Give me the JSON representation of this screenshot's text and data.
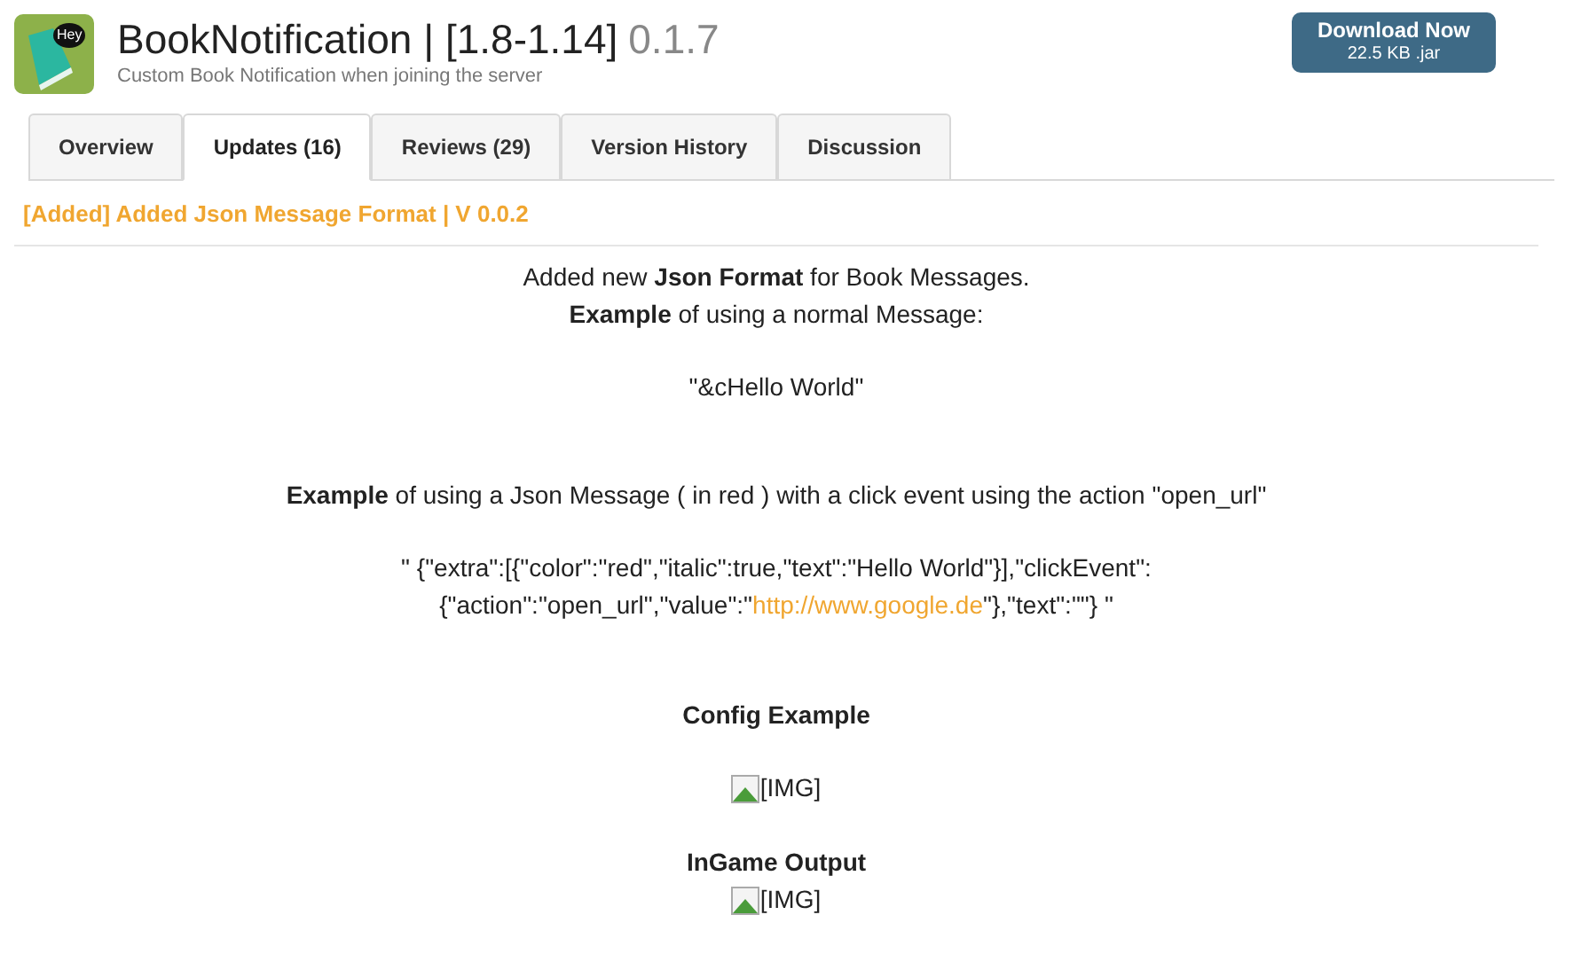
{
  "resource": {
    "name": "BookNotification | [1.8-1.14]",
    "version": "0.1.7",
    "tagline": "Custom Book Notification when joining the server",
    "icon_badge": "Hey"
  },
  "download": {
    "label": "Download Now",
    "detail": "22.5 KB .jar"
  },
  "tabs": [
    {
      "label": "Overview",
      "selected": false
    },
    {
      "label": "Updates (16)",
      "selected": true
    },
    {
      "label": "Reviews (29)",
      "selected": false
    },
    {
      "label": "Version History",
      "selected": false
    },
    {
      "label": "Discussion",
      "selected": false
    }
  ],
  "update": {
    "title": "[Added] Added Json Message Format | V 0.0.2",
    "blocks": [
      {
        "kind": "text",
        "text": "Added new **Json Format** for Book Messages."
      },
      {
        "kind": "text",
        "text": "**Example** of using a normal Message:"
      },
      {
        "kind": "text",
        "text": "\"&cHello World\""
      },
      {
        "kind": "text",
        "text": "**Example** of using a Json Message ( in red ) with a click event using the action \"open_url\""
      },
      {
        "kind": "link_text",
        "before": "\" {\"extra\":[{\"color\":\"red\",\"italic\":true,\"text\":\"Hello World\"}],\"clickEvent\": {\"action\":\"open_url\",\"value\":\"",
        "link": "http://www.google.de",
        "after": "\"},\"text\":\"\"} \""
      },
      {
        "kind": "heading",
        "text": "Config Example"
      },
      {
        "kind": "image",
        "alt": "[IMG]"
      },
      {
        "kind": "heading",
        "text": "InGame Output"
      },
      {
        "kind": "image",
        "alt": "[IMG]"
      }
    ]
  }
}
